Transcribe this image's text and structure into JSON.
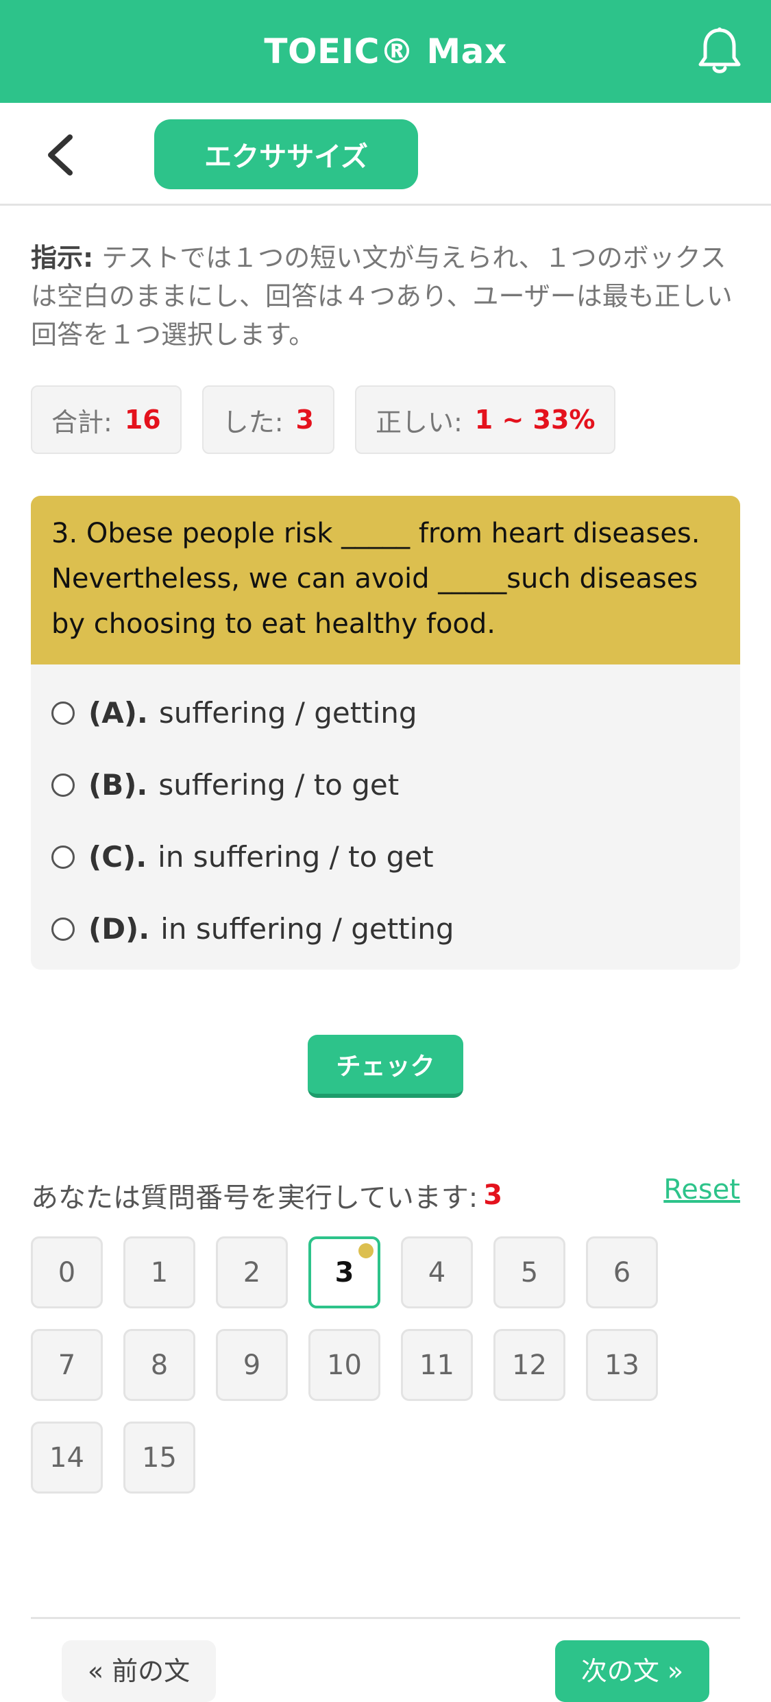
{
  "header": {
    "title": "TOEIC® Max",
    "bell_icon": "bell-icon"
  },
  "subheader": {
    "back_icon": "chevron-left-icon",
    "tab_label": "エクササイズ"
  },
  "instruction": {
    "label": "指示:",
    "text": " テストでは１つの短い文が与えられ、１つのボックスは空白のままにし、回答は４つあり、ユーザーは最も正しい回答を１つ選択します。"
  },
  "stats": {
    "total_label": "合計:",
    "total_value": "16",
    "done_label": "した:",
    "done_value": "3",
    "correct_label": "正しい:",
    "correct_value": "1 ~ 33%"
  },
  "question": {
    "text": "3. Obese people risk _____ from heart diseases. Nevertheless, we can avoid _____such diseases by choosing to eat healthy food.",
    "options": [
      {
        "label": "(A).",
        "text": "suffering / getting"
      },
      {
        "label": "(B).",
        "text": "suffering / to get"
      },
      {
        "label": "(C).",
        "text": "in suffering / to get"
      },
      {
        "label": "(D).",
        "text": "in suffering / getting"
      }
    ]
  },
  "check_label": "チェック",
  "progress": {
    "label": "あなたは質問番号を実行しています:",
    "current": "3",
    "reset_label": "Reset"
  },
  "numbers": [
    "0",
    "1",
    "2",
    "3",
    "4",
    "5",
    "6",
    "7",
    "8",
    "9",
    "10",
    "11",
    "12",
    "13",
    "14",
    "15"
  ],
  "nav": {
    "prev_label": "« 前の文",
    "next_label": "次の文 »"
  },
  "colors": {
    "primary": "#2dc38a",
    "question_bg": "#dcbf4f",
    "accent_red": "#e4121d"
  }
}
